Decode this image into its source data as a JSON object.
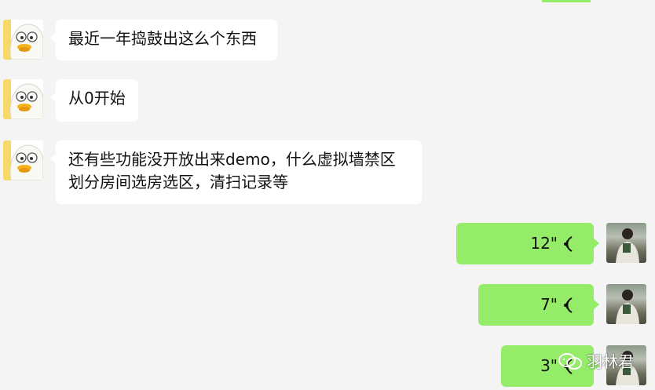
{
  "chat": {
    "incoming": [
      {
        "text": "最近一年捣鼓出这么个东西",
        "avatar_icon": "duck-avatar-icon"
      },
      {
        "text": "从0开始",
        "avatar_icon": "duck-avatar-icon"
      },
      {
        "line1": "还有些功能没开放出来demo，什么虚拟墙禁区",
        "line2": "划分房间选房选区，清扫记录等",
        "avatar_icon": "duck-avatar-icon"
      }
    ],
    "outgoing_voice": [
      {
        "duration": "12\""
      },
      {
        "duration": "7\""
      },
      {
        "duration": "3\""
      }
    ],
    "bubble_colors": {
      "incoming": "#ffffff",
      "outgoing": "#95ec69",
      "background": "#f4f4f4"
    }
  },
  "watermark": {
    "text": "羽林君",
    "icon": "wechat-icon"
  }
}
